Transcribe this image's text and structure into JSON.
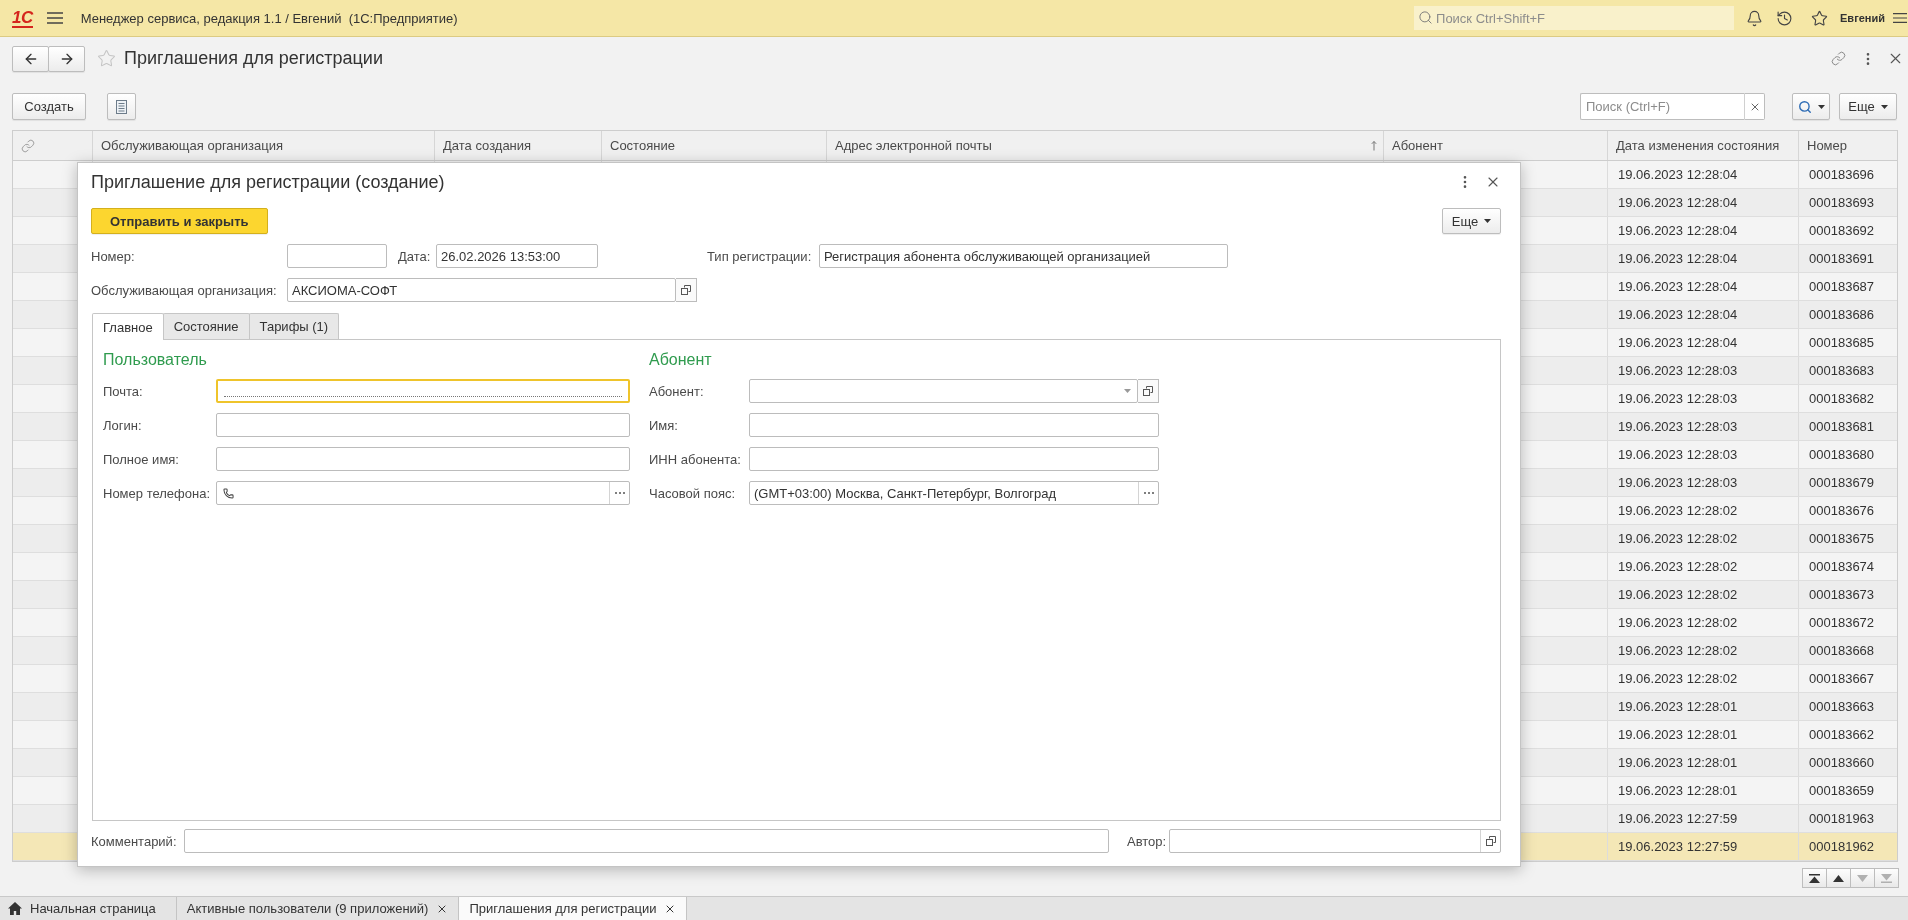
{
  "app_bar": {
    "logo": "1С",
    "title": "Менеджер сервиса, редакция 1.1 / Евгений  (1С:Предприятие)",
    "search_placeholder": "Поиск Ctrl+Shift+F",
    "user": "Евгений"
  },
  "page": {
    "title": "Приглашения для регистрации",
    "favorite": false
  },
  "toolbar": {
    "create_button": "Создать",
    "search_placeholder": "Поиск (Ctrl+F)",
    "more_button": "Еще"
  },
  "table": {
    "columns": [
      {
        "label": "Обслуживающая организация",
        "sorted": false
      },
      {
        "label": "Дата создания",
        "sorted": false
      },
      {
        "label": "Состояние",
        "sorted": false
      },
      {
        "label": "Адрес электронной почты",
        "sorted": true
      },
      {
        "label": "Абонент",
        "sorted": false
      },
      {
        "label": "Дата изменения состояния",
        "sorted": false
      },
      {
        "label": "Номер",
        "sorted": false
      }
    ],
    "rows": [
      {
        "state_changed": "19.06.2023 12:28:04",
        "number": "000183696",
        "selected": false
      },
      {
        "state_changed": "19.06.2023 12:28:04",
        "number": "000183693",
        "selected": false
      },
      {
        "state_changed": "19.06.2023 12:28:04",
        "number": "000183692",
        "selected": false
      },
      {
        "state_changed": "19.06.2023 12:28:04",
        "number": "000183691",
        "selected": false
      },
      {
        "state_changed": "19.06.2023 12:28:04",
        "number": "000183687",
        "selected": false
      },
      {
        "state_changed": "19.06.2023 12:28:04",
        "number": "000183686",
        "selected": false
      },
      {
        "state_changed": "19.06.2023 12:28:04",
        "number": "000183685",
        "selected": false
      },
      {
        "state_changed": "19.06.2023 12:28:03",
        "number": "000183683",
        "selected": false
      },
      {
        "state_changed": "19.06.2023 12:28:03",
        "number": "000183682",
        "selected": false
      },
      {
        "state_changed": "19.06.2023 12:28:03",
        "number": "000183681",
        "selected": false
      },
      {
        "state_changed": "19.06.2023 12:28:03",
        "number": "000183680",
        "selected": false
      },
      {
        "state_changed": "19.06.2023 12:28:03",
        "number": "000183679",
        "selected": false
      },
      {
        "state_changed": "19.06.2023 12:28:02",
        "number": "000183676",
        "selected": false
      },
      {
        "state_changed": "19.06.2023 12:28:02",
        "number": "000183675",
        "selected": false
      },
      {
        "state_changed": "19.06.2023 12:28:02",
        "number": "000183674",
        "selected": false
      },
      {
        "state_changed": "19.06.2023 12:28:02",
        "number": "000183673",
        "selected": false
      },
      {
        "state_changed": "19.06.2023 12:28:02",
        "number": "000183672",
        "selected": false
      },
      {
        "state_changed": "19.06.2023 12:28:02",
        "number": "000183668",
        "selected": false
      },
      {
        "state_changed": "19.06.2023 12:28:02",
        "number": "000183667",
        "selected": false
      },
      {
        "state_changed": "19.06.2023 12:28:01",
        "number": "000183663",
        "selected": false
      },
      {
        "state_changed": "19.06.2023 12:28:01",
        "number": "000183662",
        "selected": false
      },
      {
        "state_changed": "19.06.2023 12:28:01",
        "number": "000183660",
        "selected": false
      },
      {
        "state_changed": "19.06.2023 12:28:01",
        "number": "000183659",
        "selected": false
      },
      {
        "state_changed": "19.06.2023 12:27:59",
        "number": "000181963",
        "selected": false
      },
      {
        "state_changed": "19.06.2023 12:27:59",
        "number": "000181962",
        "selected": true
      }
    ]
  },
  "list_navigation": [
    {
      "kind": "first",
      "disabled": false
    },
    {
      "kind": "previous",
      "disabled": false
    },
    {
      "kind": "next",
      "disabled": true
    },
    {
      "kind": "last",
      "disabled": true
    }
  ],
  "dialog": {
    "title": "Приглашение для регистрации (создание)",
    "primary_button": "Отправить и закрыть",
    "more_button": "Еще",
    "number": {
      "label": "Номер:"
    },
    "date": {
      "label": "Дата:",
      "value": "26.02.2026 13:53:00"
    },
    "registration_type": {
      "label": "Тип регистрации:",
      "value": "Регистрация абонента обслуживающей организацией"
    },
    "organization": {
      "label": "Обслуживающая организация:",
      "value": "АКСИОМА-СОФТ"
    },
    "tabs": [
      {
        "label": "Главное",
        "selected": true
      },
      {
        "label": "Состояние",
        "selected": false
      },
      {
        "label": "Тарифы (1)",
        "selected": false
      }
    ],
    "user_section": {
      "title": "Пользователь",
      "fields": [
        {
          "kind": "text",
          "label": "Почта:",
          "focused": true
        },
        {
          "kind": "text",
          "label": "Логин:",
          "focused": false
        },
        {
          "kind": "text",
          "label": "Полное имя:",
          "focused": false
        },
        {
          "kind": "phone",
          "label": "Номер телефона:",
          "focused": false
        }
      ]
    },
    "subscriber_section": {
      "title": "Абонент",
      "fields": [
        {
          "kind": "select",
          "label": "Абонент:",
          "focused": false
        },
        {
          "kind": "text",
          "label": "Имя:",
          "focused": false
        },
        {
          "kind": "text",
          "label": "ИНН абонента:",
          "focused": false
        },
        {
          "kind": "choice",
          "label": "Часовой пояс:",
          "value": "(GMT+03:00) Москва, Санкт-Петербург, Волгоград",
          "focused": false
        }
      ]
    },
    "comment": {
      "label": "Комментарий:"
    },
    "author": {
      "label": "Автор:"
    }
  },
  "open_windows": [
    {
      "kind": "home",
      "label": "Начальная страница",
      "selected": false
    },
    {
      "kind": "window",
      "label": "Активные пользователи (9 приложений)",
      "selected": false
    },
    {
      "kind": "window",
      "label": "Приглашения для регистрации",
      "selected": true
    }
  ]
}
